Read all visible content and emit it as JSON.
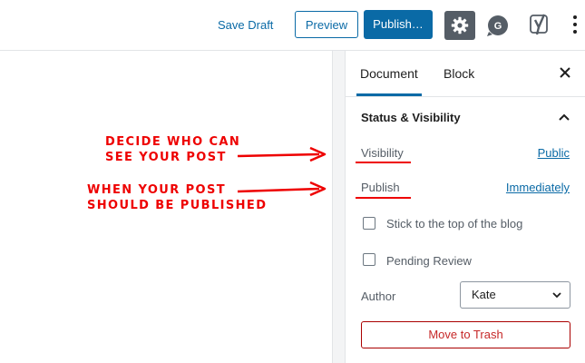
{
  "toolbar": {
    "save_draft": "Save Draft",
    "preview": "Preview",
    "publish": "Publish…",
    "icons": [
      "gear-icon",
      "grammarly-icon",
      "yoast-icon",
      "more-vertical-icon"
    ]
  },
  "sidebar": {
    "tabs": [
      {
        "label": "Document",
        "active": true
      },
      {
        "label": "Block",
        "active": false
      }
    ],
    "panel": {
      "title": "Status & Visibility",
      "visibility_label": "Visibility",
      "visibility_value": "Public",
      "publish_label": "Publish",
      "publish_value": "Immediately",
      "sticky_label": "Stick to the top of the blog",
      "pending_label": "Pending Review",
      "author_label": "Author",
      "author_value": "Kate",
      "trash_label": "Move to Trash"
    }
  },
  "annotations": {
    "visibility_note_line1": "DECIDE WHO CAN",
    "visibility_note_line2": "SEE YOUR POST",
    "publish_note_line1": "WHEN YOUR POST",
    "publish_note_line2": "SHOULD BE PUBLISHED"
  },
  "colors": {
    "accent": "#0a6aa6",
    "annotation": "#e00000",
    "trash": "#c62828",
    "settings_bg": "#555d66"
  }
}
